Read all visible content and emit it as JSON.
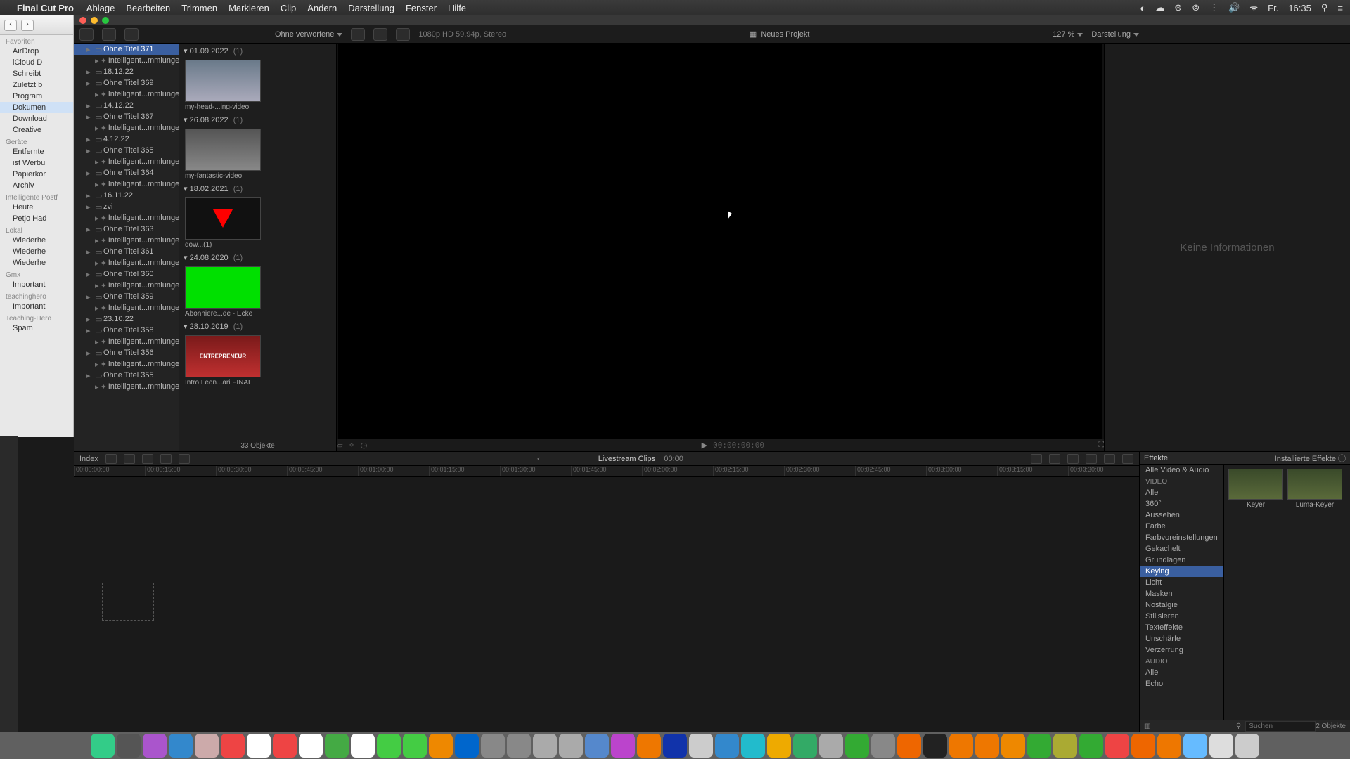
{
  "menubar": {
    "app": "Final Cut Pro",
    "items": [
      "Ablage",
      "Bearbeiten",
      "Trimmen",
      "Markieren",
      "Clip",
      "Ändern",
      "Darstellung",
      "Fenster",
      "Hilfe"
    ],
    "right": {
      "day": "Fr.",
      "time": "16:35"
    }
  },
  "finder": {
    "sections": [
      {
        "title": "Favoriten",
        "items": [
          "AirDrop",
          "iCloud D",
          "Schreibt",
          "Zuletzt b",
          "Program",
          "Dokumen",
          "Download",
          "Creative"
        ]
      },
      {
        "title": "Geräte",
        "items": [
          "Entfernte"
        ]
      },
      {
        "title": "",
        "items": [
          "ist Werbu",
          "Papierkor",
          "Archiv"
        ]
      },
      {
        "title": "Intelligente Postf",
        "items": [
          "Heute",
          "Petjo Had"
        ]
      },
      {
        "title": "Lokal",
        "items": [
          "Wiederhe",
          "Wiederhe",
          "Wiederhe"
        ]
      },
      {
        "title": "Gmx",
        "items": [
          "Important"
        ]
      },
      {
        "title": "teachinghero",
        "items": [
          "Important"
        ]
      },
      {
        "title": "Teaching-Hero",
        "items": [
          "Spam"
        ]
      }
    ],
    "selected": "Dokumen"
  },
  "toolbar": {
    "filter": "Ohne verworfene",
    "info": "1080p HD 59,94p, Stereo",
    "project_icon": "▦",
    "project": "Neues Projekt",
    "zoom": "127 %",
    "view": "Darstellung"
  },
  "library": {
    "items": [
      {
        "t": "Ohne Titel 371",
        "lvl": 1,
        "sel": true
      },
      {
        "t": "Intelligent...mmlungen",
        "lvl": 2
      },
      {
        "t": "18.12.22",
        "lvl": 1
      },
      {
        "t": "Ohne Titel 369",
        "lvl": 1
      },
      {
        "t": "Intelligent...mmlungen",
        "lvl": 2
      },
      {
        "t": "14.12.22",
        "lvl": 1
      },
      {
        "t": "Ohne Titel 367",
        "lvl": 1
      },
      {
        "t": "Intelligent...mmlungen",
        "lvl": 2
      },
      {
        "t": "4.12.22",
        "lvl": 1
      },
      {
        "t": "Ohne Titel 365",
        "lvl": 1
      },
      {
        "t": "Intelligent...mmlungen",
        "lvl": 2
      },
      {
        "t": "Ohne Titel 364",
        "lvl": 1
      },
      {
        "t": "Intelligent...mmlungen",
        "lvl": 2
      },
      {
        "t": "16.11.22",
        "lvl": 1
      },
      {
        "t": "zvi",
        "lvl": 1
      },
      {
        "t": "Intelligent...mmlungen",
        "lvl": 2
      },
      {
        "t": "Ohne Titel 363",
        "lvl": 1
      },
      {
        "t": "Intelligent...mmlungen",
        "lvl": 2
      },
      {
        "t": "Ohne Titel 361",
        "lvl": 1
      },
      {
        "t": "Intelligent...mmlungen",
        "lvl": 2
      },
      {
        "t": "Ohne Titel 360",
        "lvl": 1
      },
      {
        "t": "Intelligent...mmlungen",
        "lvl": 2
      },
      {
        "t": "Ohne Titel 359",
        "lvl": 1
      },
      {
        "t": "Intelligent...mmlungen",
        "lvl": 2
      },
      {
        "t": "23.10.22",
        "lvl": 1
      },
      {
        "t": "Ohne Titel 358",
        "lvl": 1
      },
      {
        "t": "Intelligent...mmlungen",
        "lvl": 2
      },
      {
        "t": "Ohne Titel 356",
        "lvl": 1
      },
      {
        "t": "Intelligent...mmlungen",
        "lvl": 2
      },
      {
        "t": "Ohne Titel 355",
        "lvl": 1
      },
      {
        "t": "Intelligent...mmlungen",
        "lvl": 2
      }
    ]
  },
  "browser": {
    "groups": [
      {
        "date": "01.09.2022",
        "count": "(1)",
        "thumb": {
          "cap": "my-head-...ing-video",
          "bg": "linear-gradient(#6a7a8a,#aab)"
        }
      },
      {
        "date": "26.08.2022",
        "count": "(1)",
        "thumb": {
          "cap": "my-fantastic-video",
          "bg": "linear-gradient(#555,#888)"
        }
      },
      {
        "date": "18.02.2021",
        "count": "(1)",
        "thumb": {
          "cap": "dow...(1)",
          "bg": "#111",
          "arrow": true
        }
      },
      {
        "date": "24.08.2020",
        "count": "(1)",
        "thumb": {
          "cap": "Abonniere...de - Ecke",
          "bg": "#00e000"
        }
      },
      {
        "date": "28.10.2019",
        "count": "(1)",
        "thumb": {
          "cap": "Intro Leon...ari FINAL",
          "bg": "linear-gradient(#7a1a1a,#c03030)",
          "badge": "ENTREPRENEUR"
        }
      }
    ],
    "footer": "33 Objekte"
  },
  "viewer": {
    "timecode": "00:00:00:00"
  },
  "inspector": {
    "empty": "Keine Informationen"
  },
  "timeline": {
    "index": "Index",
    "title": "Livestream Clips",
    "dur": "00:00",
    "ruler": [
      "00:00:00:00",
      "00:00:15:00",
      "00:00:30:00",
      "00:00:45:00",
      "00:01:00:00",
      "00:01:15:00",
      "00:01:30:00",
      "00:01:45:00",
      "00:02:00:00",
      "00:02:15:00",
      "00:02:30:00",
      "00:02:45:00",
      "00:03:00:00",
      "00:03:15:00",
      "00:03:30:00"
    ]
  },
  "effects": {
    "title": "Effekte",
    "installed": "Installierte Effekte",
    "cats_video_hd": "VIDEO",
    "cats_audio_hd": "AUDIO",
    "cats": [
      "Alle Video & Audio",
      "Alle",
      "360°",
      "Aussehen",
      "Farbe",
      "Farbvoreinstellungen",
      "Gekachelt",
      "Grundlagen",
      "Keying",
      "Licht",
      "Masken",
      "Nostalgie",
      "Stilisieren",
      "Texteffekte",
      "Unschärfe",
      "Verzerrung"
    ],
    "cats_audio": [
      "Alle",
      "Echo"
    ],
    "selected": "Keying",
    "thumbs": [
      {
        "label": "Keyer"
      },
      {
        "label": "Luma-Keyer"
      }
    ],
    "search_ph": "Suchen",
    "count": "2 Objekte"
  },
  "dock_colors": [
    "#3c8",
    "#555",
    "#a5c",
    "#38c",
    "#caa",
    "#e44",
    "#fff",
    "#e44",
    "#fff",
    "#4a4",
    "#fff",
    "#4c4",
    "#4c4",
    "#e80",
    "#06c",
    "#888",
    "#888",
    "#aaa",
    "#aaa",
    "#58c",
    "#b4c",
    "#e70",
    "#13a",
    "#ccc",
    "#38c",
    "#2bc",
    "#ea0",
    "#3a6",
    "#aaa",
    "#3a3",
    "#888",
    "#e60",
    "#222",
    "#e70",
    "#e70",
    "#e80",
    "#3a3",
    "#aa3",
    "#3a3",
    "#e44",
    "#e60",
    "#e70",
    "#6bf",
    "#ddd",
    "#ccc"
  ]
}
